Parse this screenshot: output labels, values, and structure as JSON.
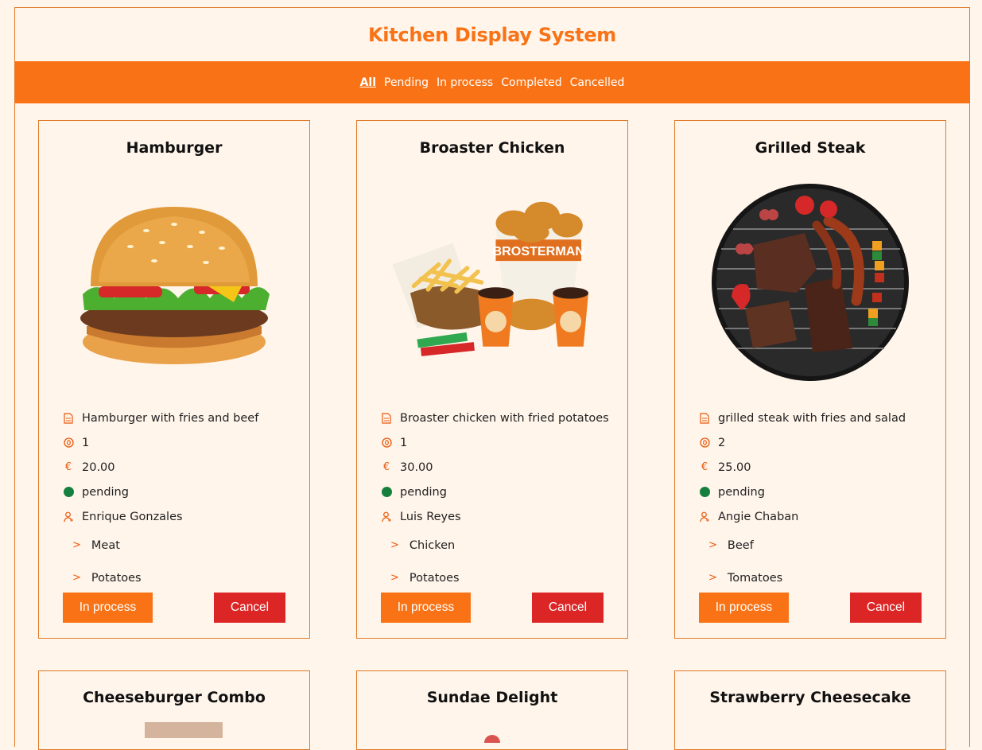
{
  "app": {
    "title": "Kitchen Display System"
  },
  "filters": [
    "All",
    "Pending",
    "In process",
    "Completed",
    "Cancelled"
  ],
  "buttons": {
    "in_process": "In process",
    "cancel": "Cancel"
  },
  "orders": [
    {
      "name": "Hamburger",
      "image": "hamburger",
      "description": "Hamburger with fries and beef",
      "quantity": "1",
      "price": "20.00",
      "status": "pending",
      "customer": "Enrique Gonzales",
      "ingredients": [
        "Meat",
        "Potatoes"
      ]
    },
    {
      "name": "Broaster Chicken",
      "image": "broaster-chicken",
      "description": "Broaster chicken with fried potatoes",
      "quantity": "1",
      "price": "30.00",
      "status": "pending",
      "customer": "Luis Reyes",
      "ingredients": [
        "Chicken",
        "Potatoes"
      ]
    },
    {
      "name": "Grilled Steak",
      "image": "grilled-steak",
      "description": "grilled steak with fries and salad",
      "quantity": "2",
      "price": "25.00",
      "status": "pending",
      "customer": "Angie Chaban",
      "ingredients": [
        "Beef",
        "Tomatoes"
      ]
    },
    {
      "name": "Cheeseburger Combo"
    },
    {
      "name": "Sundae Delight"
    },
    {
      "name": "Strawberry Cheesecake"
    }
  ],
  "colors": {
    "accent": "#f97316",
    "cancel": "#dc2626",
    "status_pending": "#15803d",
    "background": "#fff5eb"
  }
}
